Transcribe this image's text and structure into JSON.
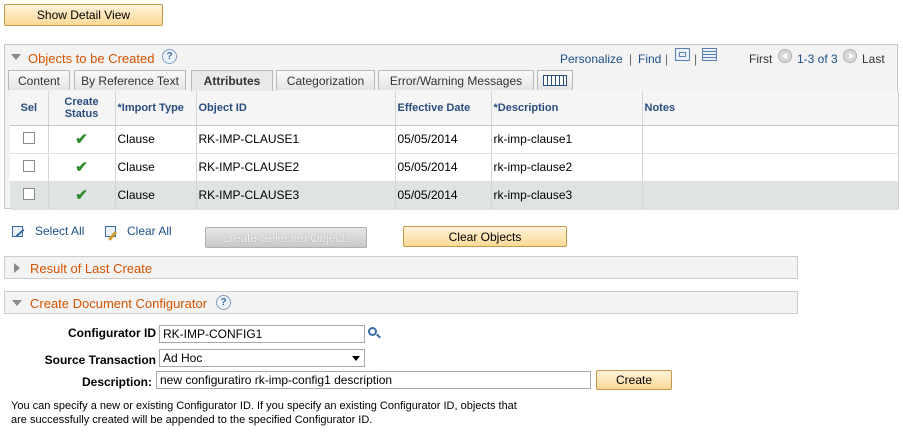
{
  "buttons": {
    "show_detail": "Show Detail View",
    "create_selected": "Create Selected Objects",
    "clear_objects": "Clear Objects",
    "create": "Create"
  },
  "grid": {
    "title": "Objects to be Created",
    "personalize": "Personalize",
    "separator": "|",
    "find": "Find",
    "first": "First",
    "range": "1-3 of 3",
    "last": "Last",
    "tabs": [
      "Content",
      "By Reference Text",
      "Attributes",
      "Categorization",
      "Error/Warning Messages"
    ],
    "headers": {
      "sel": "Sel",
      "create_status": "Create Status",
      "import_type": "*Import Type",
      "object_id": "Object ID",
      "effective_date": "Effective Date",
      "description": "*Description",
      "notes": "Notes"
    },
    "rows": [
      {
        "status": "✔",
        "import_type": "Clause",
        "object_id": "RK-IMP-CLAUSE1",
        "effective_date": "05/05/2014",
        "description": "rk-imp-clause1",
        "notes": ""
      },
      {
        "status": "✔",
        "import_type": "Clause",
        "object_id": "RK-IMP-CLAUSE2",
        "effective_date": "05/05/2014",
        "description": "rk-imp-clause2",
        "notes": ""
      },
      {
        "status": "✔",
        "import_type": "Clause",
        "object_id": "RK-IMP-CLAUSE3",
        "effective_date": "05/05/2014",
        "description": "rk-imp-clause3",
        "notes": ""
      }
    ]
  },
  "actions": {
    "select_all": "Select All",
    "clear_all": "Clear All"
  },
  "sections": {
    "result": "Result of Last Create",
    "configurator": "Create Document Configurator"
  },
  "form": {
    "configurator_id_label": "Configurator ID",
    "configurator_id_value": "RK-IMP-CONFIG1",
    "source_label": "Source Transaction",
    "source_value": "Ad Hoc",
    "description_label": "Description:",
    "description_value": "new configuratiro rk-imp-config1 description"
  },
  "notes": {
    "line1": "You can specify a new  or existing Configurator ID. If you specify an existing Configurator ID, objects that",
    "line2": "are successfully created will be appended to the specified Configurator ID."
  },
  "colors": {
    "accent_orange": "#d35400",
    "link_blue": "#1b4f8a",
    "check_green": "#2e8b2e"
  }
}
